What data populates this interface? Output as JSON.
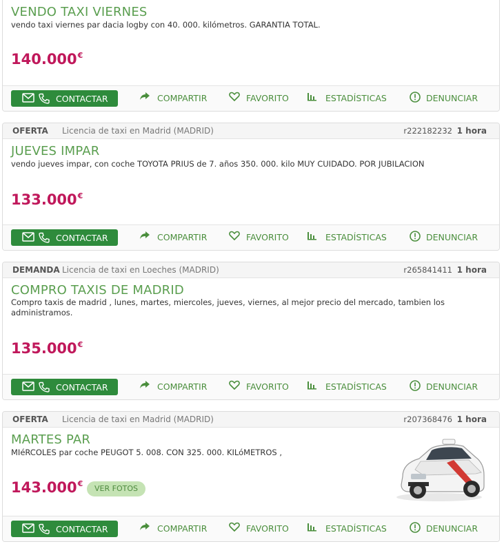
{
  "colors": {
    "accent_green": "#2e8b3c",
    "title_green": "#5a9e4f",
    "price": "#c0185b"
  },
  "actions": {
    "contact": "CONTACTAR",
    "share": "COMPARTIR",
    "favorite": "FAVORITO",
    "stats": "ESTADÍSTICAS",
    "report": "DENUNCIAR"
  },
  "listings": [
    {
      "title": "VENDO TAXI VIERNES",
      "description": "vendo taxi viernes par dacia logby con 40. 000. kilómetros. GARANTIA TOTAL.",
      "price": "140.000",
      "currency": "€"
    },
    {
      "type": "OFERTA",
      "location": "Licencia de taxi en Madrid (MADRID)",
      "ref": "r222182232",
      "time": "1 hora",
      "title": "JUEVES IMPAR",
      "description": "vendo jueves impar, con coche TOYOTA PRIUS de 7. años 350. 000. kilo MUY CUIDADO. POR JUBILACION",
      "price": "133.000",
      "currency": "€"
    },
    {
      "type": "DEMANDA",
      "location": "Licencia de taxi en Loeches (MADRID)",
      "ref": "r265841411",
      "time": "1 hora",
      "title": "COMPRO TAXIS DE MADRID",
      "description": "Compro taxis de madrid , lunes, martes, miercoles, jueves, viernes, al mejor precio del mercado, tambien los administramos.",
      "price": "135.000",
      "currency": "€"
    },
    {
      "type": "OFERTA",
      "location": "Licencia de taxi en Madrid (MADRID)",
      "ref": "r207368476",
      "time": "1 hora",
      "title": "MARTES PAR",
      "description": "MIéRCOLES par coche PEUGOT 5. 008. CON 325. 000. KILóMETROS ,",
      "price": "143.000",
      "currency": "€",
      "photos_label": "VER FOTOS"
    }
  ]
}
